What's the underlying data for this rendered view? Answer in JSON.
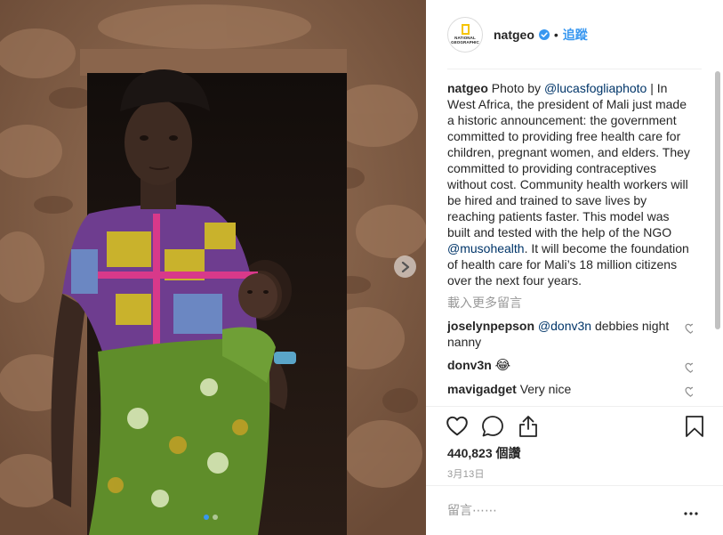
{
  "post": {
    "username": "natgeo",
    "avatar_text": [
      "NATIONAL",
      "GEOGRAPHIC"
    ],
    "bullet": "•",
    "follow_label": "追蹤",
    "caption": {
      "author": "natgeo",
      "pre": "Photo by",
      "mention1": "@lucasfogliaphoto",
      "mid": "| In West Africa, the president of Mali just made a historic announcement: the government committed to providing free health care for children, pregnant women, and elders. They committed to providing contraceptives without cost. Community health workers will be hired and trained to save lives by reaching patients faster. This model was built and tested with the help of the NGO",
      "mention2": "@musohealth",
      "post": ". It will become the foundation of health care for Mali’s 18 million citizens over the next four years."
    },
    "load_more": "載入更多留言",
    "comments": [
      {
        "user": "joselynpepson",
        "mention": "@donv3n",
        "text": "debbies night nanny"
      },
      {
        "user": "donv3n",
        "mention": "",
        "text": "😂"
      },
      {
        "user": "mavigadget",
        "mention": "",
        "text": "Very nice"
      }
    ],
    "likes": "440,823 個讚",
    "date": "3月13日",
    "comment_placeholder": "留言⋯⋯",
    "more_label": "•••"
  },
  "carousel": {
    "count": 2,
    "active_index": 0
  },
  "icons": {
    "heart": "heart-icon",
    "comment": "comment-icon",
    "share": "share-icon",
    "save": "bookmark-icon",
    "verified": "verified-badge-icon",
    "next": "chevron-right-icon"
  },
  "colors": {
    "link": "#3897f0",
    "mention": "#003569",
    "muted": "#999999",
    "text": "#262626",
    "verified": "#3897f0"
  }
}
